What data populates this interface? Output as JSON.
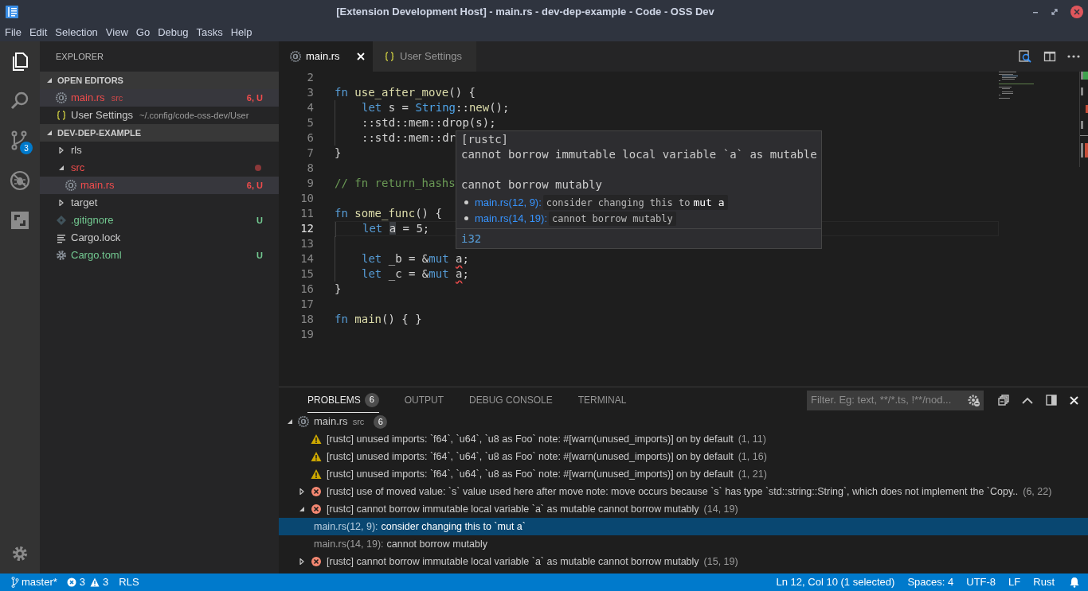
{
  "window": {
    "title": "[Extension Development Host] - main.rs - dev-dep-example - Code - OSS Dev"
  },
  "menu": [
    "File",
    "Edit",
    "Selection",
    "View",
    "Go",
    "Debug",
    "Tasks",
    "Help"
  ],
  "activity_bar": {
    "items": [
      {
        "kind": "files",
        "selected": true
      },
      {
        "kind": "search",
        "selected": false
      },
      {
        "kind": "scm",
        "selected": false,
        "badge": "3"
      },
      {
        "kind": "debug",
        "selected": false
      },
      {
        "kind": "extensions",
        "selected": false
      }
    ]
  },
  "sidebar": {
    "title": "EXPLORER",
    "sections": [
      {
        "title": "OPEN EDITORS",
        "expanded": true,
        "items": [
          {
            "name": "main.rs",
            "kind": "rust",
            "description": "src",
            "color": "#f14c4c",
            "badge": "6, U",
            "selected": true
          },
          {
            "name": "User Settings",
            "kind": "json",
            "description": "~/.config/code-oss-dev/User",
            "selected": false
          }
        ]
      },
      {
        "title": "DEV-DEP-EXAMPLE",
        "expanded": true,
        "items": [
          {
            "name": "rls",
            "kind": "folder",
            "expanded": false,
            "selected": false
          },
          {
            "name": "src",
            "kind": "folder",
            "expanded": true,
            "color": "#f14c4c",
            "selected": false,
            "children": [
              {
                "name": "main.rs",
                "kind": "rust",
                "color": "#f14c4c",
                "badge": "6, U",
                "selected": true
              }
            ]
          },
          {
            "name": "target",
            "kind": "folder",
            "expanded": false,
            "selected": false
          },
          {
            "name": ".gitignore",
            "kind": "git",
            "color": "#73c991",
            "badge": "U",
            "selected": false
          },
          {
            "name": "Cargo.lock",
            "kind": "lines",
            "selected": false
          },
          {
            "name": "Cargo.toml",
            "kind": "gear",
            "color": "#73c991",
            "badge": "U",
            "selected": false
          }
        ]
      }
    ]
  },
  "editor": {
    "tabs": [
      {
        "label": "main.rs",
        "kind": "rust",
        "selected": true
      },
      {
        "label": "User Settings",
        "kind": "json",
        "selected": false
      }
    ],
    "lines": [
      {
        "n": "2"
      },
      {
        "n": "3",
        "tokens": [
          {
            "t": "fn ",
            "kind": "kw"
          },
          {
            "t": "use_after_move",
            "kind": "fn"
          },
          {
            "t": "() {",
            "kind": "plain"
          }
        ]
      },
      {
        "n": "4",
        "guide": true,
        "tokens": [
          {
            "t": "let",
            "kind": "kw"
          },
          {
            "t": " s = ",
            "kind": "plain"
          },
          {
            "t": "String",
            "kind": "type"
          },
          {
            "t": "::",
            "kind": "plain"
          },
          {
            "t": "new",
            "kind": "fn"
          },
          {
            "t": "();",
            "kind": "plain"
          }
        ]
      },
      {
        "n": "5",
        "guide": true,
        "tokens": [
          {
            "t": "::std::mem::drop(s);",
            "kind": "plain"
          }
        ]
      },
      {
        "n": "6",
        "guide": true,
        "tokens": [
          {
            "t": "::std::mem::dr",
            "kind": "plain"
          }
        ]
      },
      {
        "n": "7",
        "tokens": [
          {
            "t": "}",
            "kind": "plain"
          }
        ]
      },
      {
        "n": "8"
      },
      {
        "n": "9",
        "tokens": [
          {
            "t": "// fn return_hashs",
            "kind": "comment"
          }
        ]
      },
      {
        "n": "10"
      },
      {
        "n": "11",
        "tokens": [
          {
            "t": "fn ",
            "kind": "kw"
          },
          {
            "t": "some_func",
            "kind": "fn"
          },
          {
            "t": "() {",
            "kind": "plain"
          }
        ]
      },
      {
        "n": "12",
        "guide": true,
        "current": true,
        "tokens": [
          {
            "t": "let ",
            "kind": "kw"
          },
          {
            "t": "a",
            "kind": "plain",
            "highlight": true
          },
          {
            "t": " = 5;",
            "kind": "plain"
          }
        ]
      },
      {
        "n": "13",
        "guide": true
      },
      {
        "n": "14",
        "guide": true,
        "tokens": [
          {
            "t": "let",
            "kind": "kw"
          },
          {
            "t": " _b = &",
            "kind": "plain"
          },
          {
            "t": "mut ",
            "kind": "kw"
          },
          {
            "t": "a",
            "kind": "plain",
            "error": true
          },
          {
            "t": ";",
            "kind": "plain"
          }
        ]
      },
      {
        "n": "15",
        "guide": true,
        "tokens": [
          {
            "t": "let",
            "kind": "kw"
          },
          {
            "t": " _c = &",
            "kind": "plain"
          },
          {
            "t": "mut ",
            "kind": "kw"
          },
          {
            "t": "a",
            "kind": "plain",
            "error": true
          },
          {
            "t": ";",
            "kind": "plain"
          }
        ]
      },
      {
        "n": "16",
        "tokens": [
          {
            "t": "}",
            "kind": "plain"
          }
        ]
      },
      {
        "n": "17"
      },
      {
        "n": "18",
        "tokens": [
          {
            "t": "fn ",
            "kind": "kw"
          },
          {
            "t": "main",
            "kind": "fn"
          },
          {
            "t": "() { }",
            "kind": "plain"
          }
        ]
      },
      {
        "n": "19"
      }
    ],
    "hover": {
      "source": "[rustc]",
      "message": "cannot borrow immutable local variable `a` as mutable",
      "detail": "cannot borrow mutably",
      "related": [
        {
          "link": "main.rs(12, 9):",
          "text": "consider changing this to",
          "code": "mut a"
        },
        {
          "link": "main.rs(14, 19):",
          "text": "cannot borrow mutably"
        }
      ],
      "type": "i32"
    }
  },
  "panel": {
    "tabs": [
      {
        "label": "PROBLEMS",
        "badge": "6",
        "selected": true
      },
      {
        "label": "OUTPUT",
        "selected": false
      },
      {
        "label": "DEBUG CONSOLE",
        "selected": false
      },
      {
        "label": "TERMINAL",
        "selected": false
      }
    ],
    "filter": {
      "placeholder": "Filter. Eg: text, **/*.ts, !**/nod..."
    },
    "problems": {
      "file": "main.rs",
      "folder": "src",
      "count": "6",
      "expanded": true,
      "items": [
        {
          "kind": "warning",
          "source": "[rustc]",
          "message": "unused imports: `f64`, `u64`, `u8 as Foo` note: #[warn(unused_imports)] on by default",
          "location": "(1, 11)"
        },
        {
          "kind": "warning",
          "source": "[rustc]",
          "message": "unused imports: `f64`, `u64`, `u8 as Foo` note: #[warn(unused_imports)] on by default",
          "location": "(1, 16)"
        },
        {
          "kind": "warning",
          "source": "[rustc]",
          "message": "unused imports: `f64`, `u64`, `u8 as Foo` note: #[warn(unused_imports)] on by default",
          "location": "(1, 21)"
        },
        {
          "kind": "error",
          "expanded": false,
          "source": "[rustc]",
          "message": "use of moved value: `s` value used here after move note: move occurs because `s` has type `std::string::String`, which does not implement the `Copy..",
          "location": "(6, 22)"
        },
        {
          "kind": "error",
          "expanded": true,
          "source": "[rustc]",
          "message": "cannot borrow immutable local variable `a` as mutable cannot borrow mutably",
          "location": "(14, 19)",
          "children": [
            {
              "file": "main.rs(12, 9):",
              "message": "consider changing this to `mut a`",
              "selected": true
            },
            {
              "file": "main.rs(14, 19):",
              "message": "cannot borrow mutably",
              "selected": false
            }
          ]
        },
        {
          "kind": "error",
          "expanded": false,
          "source": "[rustc]",
          "message": "cannot borrow immutable local variable `a` as mutable cannot borrow mutably",
          "location": "(15, 19)"
        }
      ]
    }
  },
  "status_bar": {
    "branch": "master*",
    "errors": "3",
    "warnings": "3",
    "left": [
      "RLS"
    ],
    "right": [
      "Ln 12, Col 10 (1 selected)",
      "Spaces: 4",
      "UTF-8",
      "LF",
      "Rust"
    ]
  }
}
